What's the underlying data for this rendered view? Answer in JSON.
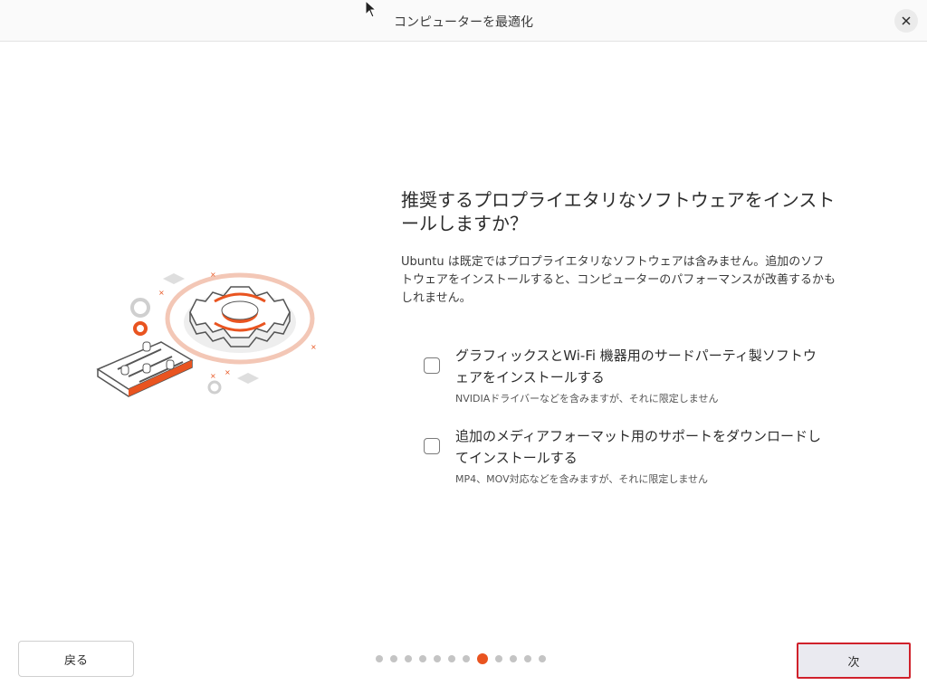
{
  "window": {
    "title": "コンピューターを最適化"
  },
  "page": {
    "heading": "推奨するプロプライエタリなソフトウェアをインストールしますか？",
    "description": "Ubuntu は既定ではプロプライエタリなソフトウェアは含みません。追加のソフトウェアをインストールすると、コンピューターのパフォーマンスが改善するかもしれません。"
  },
  "options": [
    {
      "label": "グラフィックスとWi-Fi 機器用のサードパーティ製ソフトウェアをインストールする",
      "sublabel": "NVIDIAドライバーなどを含みますが、それに限定しません",
      "checked": false
    },
    {
      "label": "追加のメディアフォーマット用のサポートをダウンロードしてインストールする",
      "sublabel": "MP4、MOV対応などを含みますが、それに限定しません",
      "checked": false
    }
  ],
  "footer": {
    "back_label": "戻る",
    "next_label": "次",
    "progress": {
      "total": 12,
      "current": 8
    }
  },
  "colors": {
    "accent": "#e95420",
    "highlight_border": "#d0212b"
  },
  "icons": {
    "close": "close-icon",
    "cursor": "mouse-pointer-icon",
    "illustration": "gear-settings-illustration"
  }
}
